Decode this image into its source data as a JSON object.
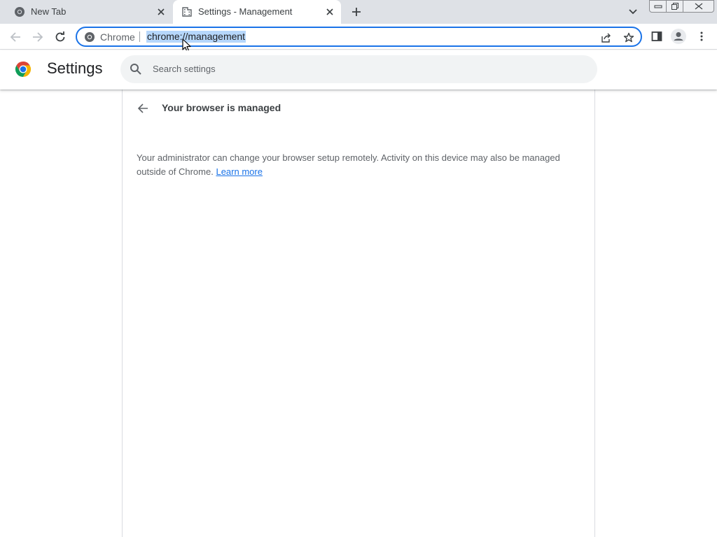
{
  "tabs": [
    {
      "title": "New Tab",
      "icon": "chrome-icon",
      "active": false
    },
    {
      "title": "Settings - Management",
      "icon": "building-icon",
      "active": true
    }
  ],
  "toolbar": {
    "site_name": "Chrome",
    "url": "chrome://management"
  },
  "header": {
    "title": "Settings",
    "search_placeholder": "Search settings"
  },
  "content": {
    "page_title": "Your browser is managed",
    "body_text": "Your administrator can change your browser setup remotely. Activity on this device may also be managed outside of Chrome.",
    "learn_more": "Learn more"
  },
  "colors": {
    "accent": "#1a73e8",
    "tabstrip_bg": "#dee1e6",
    "url_selection": "#b6d7fb"
  }
}
